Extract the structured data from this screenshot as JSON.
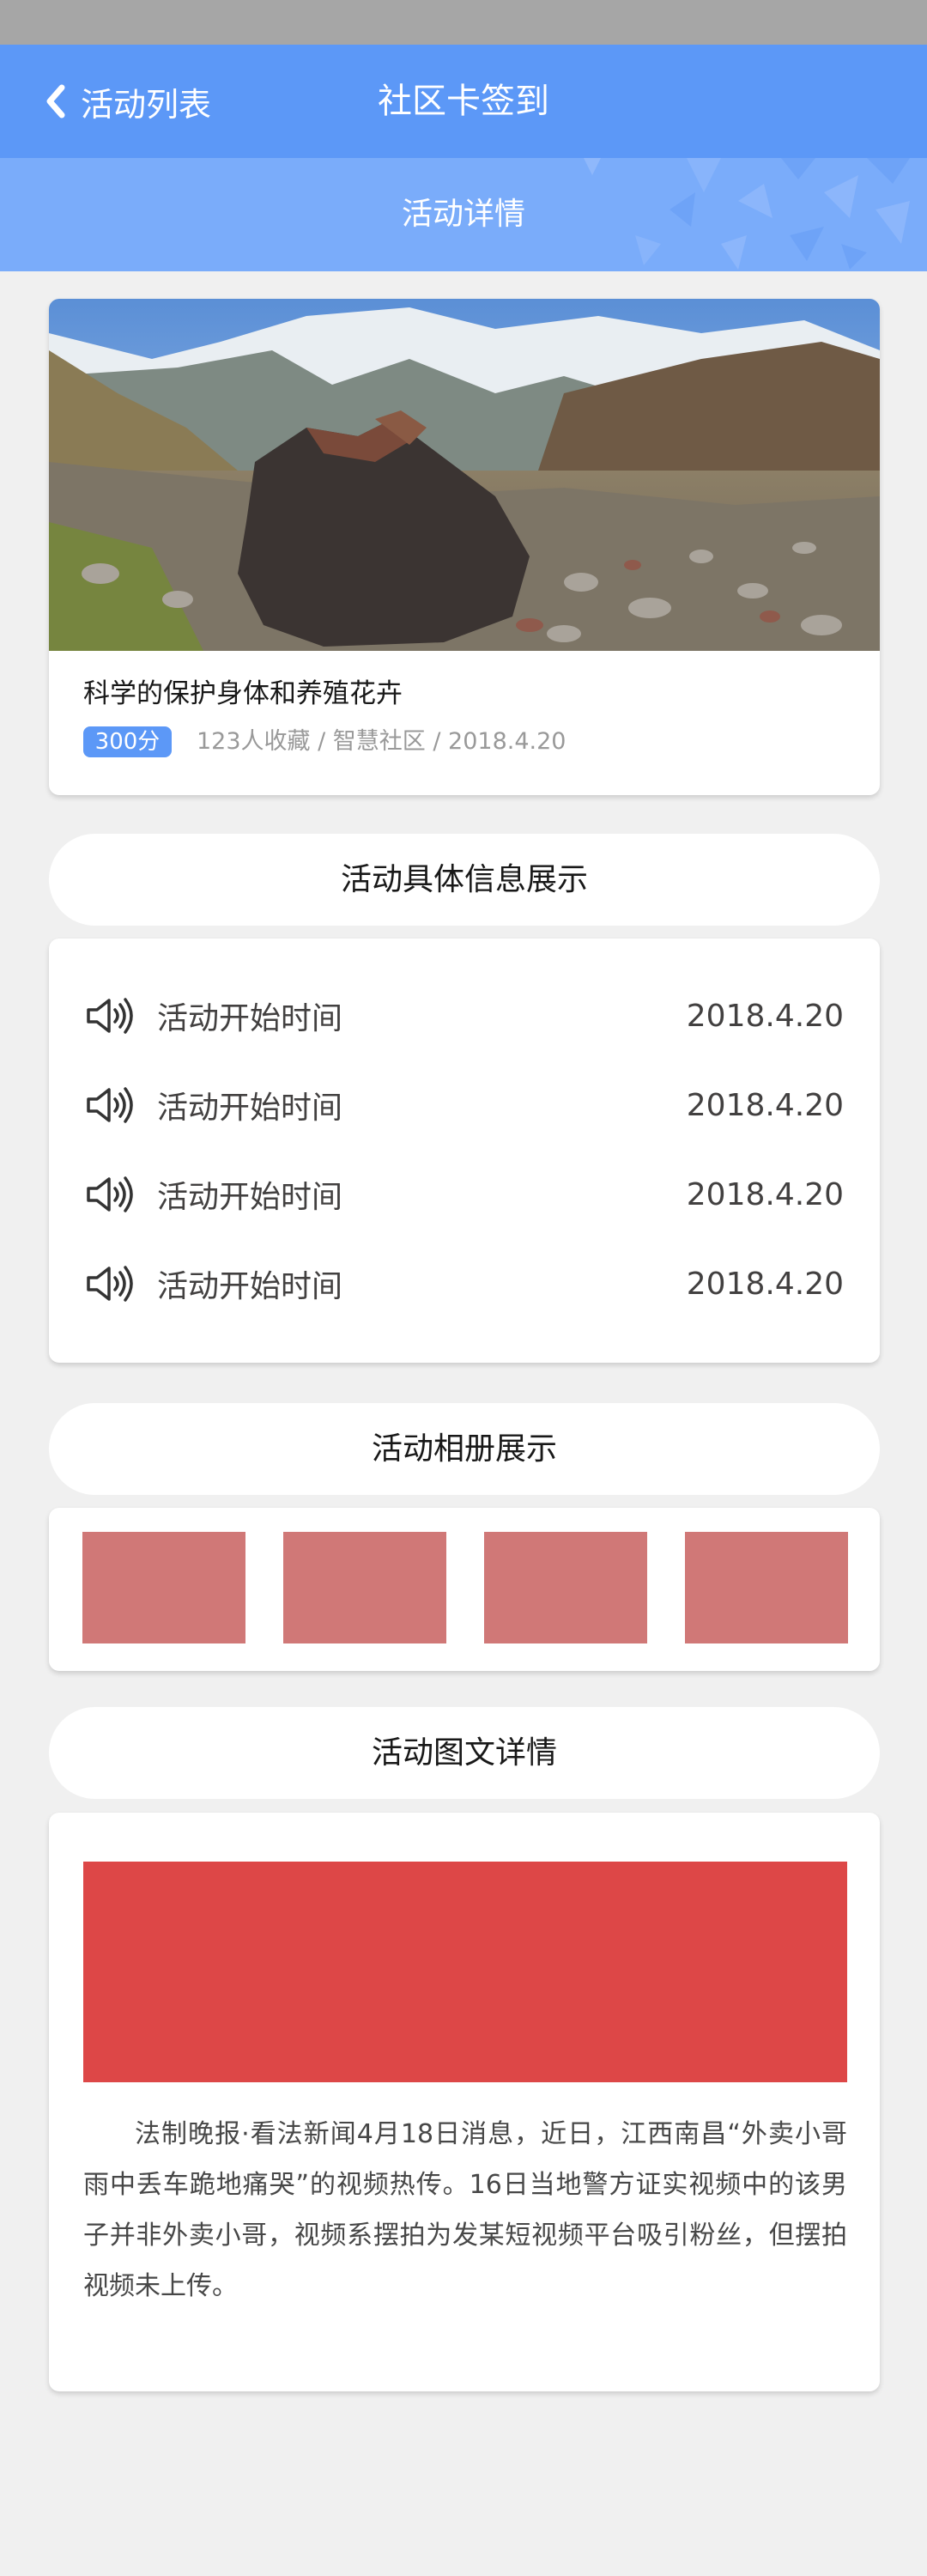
{
  "nav": {
    "back_label": "活动列表",
    "title": "社区卡签到"
  },
  "subheader": {
    "title": "活动详情"
  },
  "hero": {
    "title": "科学的保护身体和养殖花卉",
    "points_badge": "300分",
    "meta": "123人收藏 / 智慧社区 / 2018.4.20"
  },
  "sections": {
    "info_title": "活动具体信息展示",
    "album_title": "活动相册展示",
    "detail_title": "活动图文详情"
  },
  "info_rows": [
    {
      "label": "活动开始时间",
      "value": "2018.4.20"
    },
    {
      "label": "活动开始时间",
      "value": "2018.4.20"
    },
    {
      "label": "活动开始时间",
      "value": "2018.4.20"
    },
    {
      "label": "活动开始时间",
      "value": "2018.4.20"
    }
  ],
  "article": {
    "text": "法制晚报·看法新闻4月18日消息，近日，江西南昌“外卖小哥雨中丢车跪地痛哭”的视频热传。16日当地警方证实视频中的该男子并非外卖小哥，视频系摆拍为发某短视频平台吸引粉丝，但摆拍视频未上传。"
  },
  "colors": {
    "nav_blue": "#5c98f7",
    "sub_blue": "#7aacfa",
    "thumb": "#d07877",
    "banner": "#dd4747",
    "text_dark": "#181818",
    "text_row": "#424040",
    "text_article": "#474747"
  },
  "icons": {
    "back": "chevron-left-icon",
    "speaker": "speaker-icon"
  }
}
